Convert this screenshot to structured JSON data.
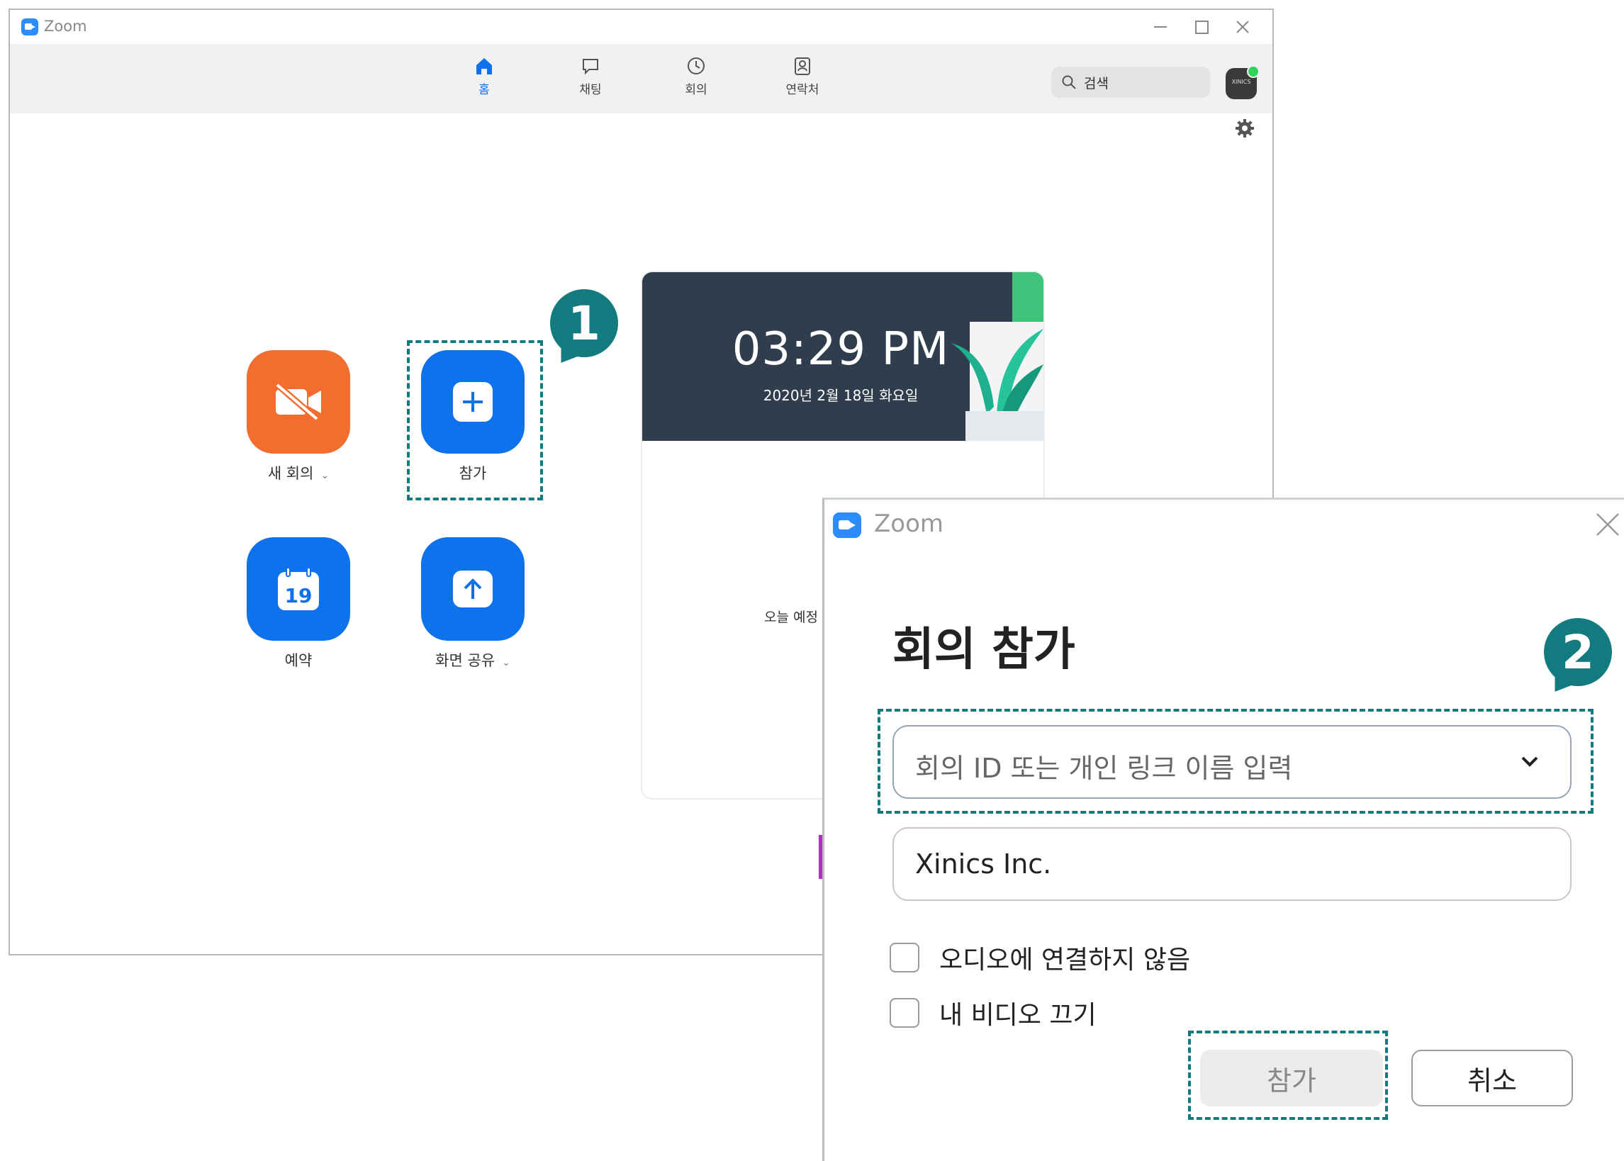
{
  "main_window": {
    "title": "Zoom",
    "nav": {
      "home": "홈",
      "chat": "채팅",
      "meetings": "회의",
      "contacts": "연락처"
    },
    "search_placeholder": "검색",
    "avatar_text": "XINICS",
    "actions": {
      "new_meeting": "새 회의",
      "join": "참가",
      "schedule": "예약",
      "share_screen": "화면 공유",
      "calendar_day": "19"
    },
    "clock": {
      "time": "03:29 PM",
      "date": "2020년 2월 18일 화요일",
      "today_note": "오늘 예정"
    }
  },
  "steps": {
    "one": "1",
    "two": "2"
  },
  "join_dialog": {
    "title": "Zoom",
    "heading": "회의 참가",
    "meeting_id_placeholder": "회의 ID 또는 개인 링크 이름 입력",
    "name_value": "Xinics Inc.",
    "options": {
      "no_audio": "오디오에 연결하지 않음",
      "video_off": "내 비디오 끄기"
    },
    "buttons": {
      "join": "참가",
      "cancel": "취소"
    }
  },
  "colors": {
    "accent_blue": "#0e72ed",
    "new_meeting_orange": "#f36d2f",
    "highlight_teal": "#137a80",
    "clock_banner": "#2f3d4d"
  }
}
